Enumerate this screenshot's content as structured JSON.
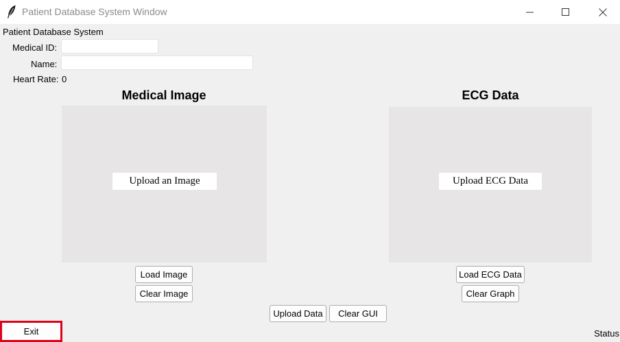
{
  "window": {
    "title": "Patient Database System Window",
    "icon": "feather-icon"
  },
  "form": {
    "app_label": "Patient Database System",
    "medical_id_label": "Medical ID:",
    "medical_id_value": "",
    "name_label": "Name:",
    "name_value": "",
    "heart_rate_label": "Heart Rate:",
    "heart_rate_value": "0"
  },
  "image_section": {
    "heading": "Medical Image",
    "placeholder": "Upload an Image",
    "load_button": "Load Image",
    "clear_button": "Clear Image"
  },
  "ecg_section": {
    "heading": "ECG Data",
    "placeholder": "Upload ECG Data",
    "load_button": "Load ECG Data",
    "clear_button": "Clear Graph"
  },
  "actions": {
    "upload_button": "Upload Data",
    "clear_gui_button": "Clear GUI",
    "exit_button": "Exit",
    "status": "Status"
  },
  "colors": {
    "exit_highlight": "#e0001a",
    "panel_bg": "#e7e5e6",
    "window_bg": "#f0f0f0"
  }
}
